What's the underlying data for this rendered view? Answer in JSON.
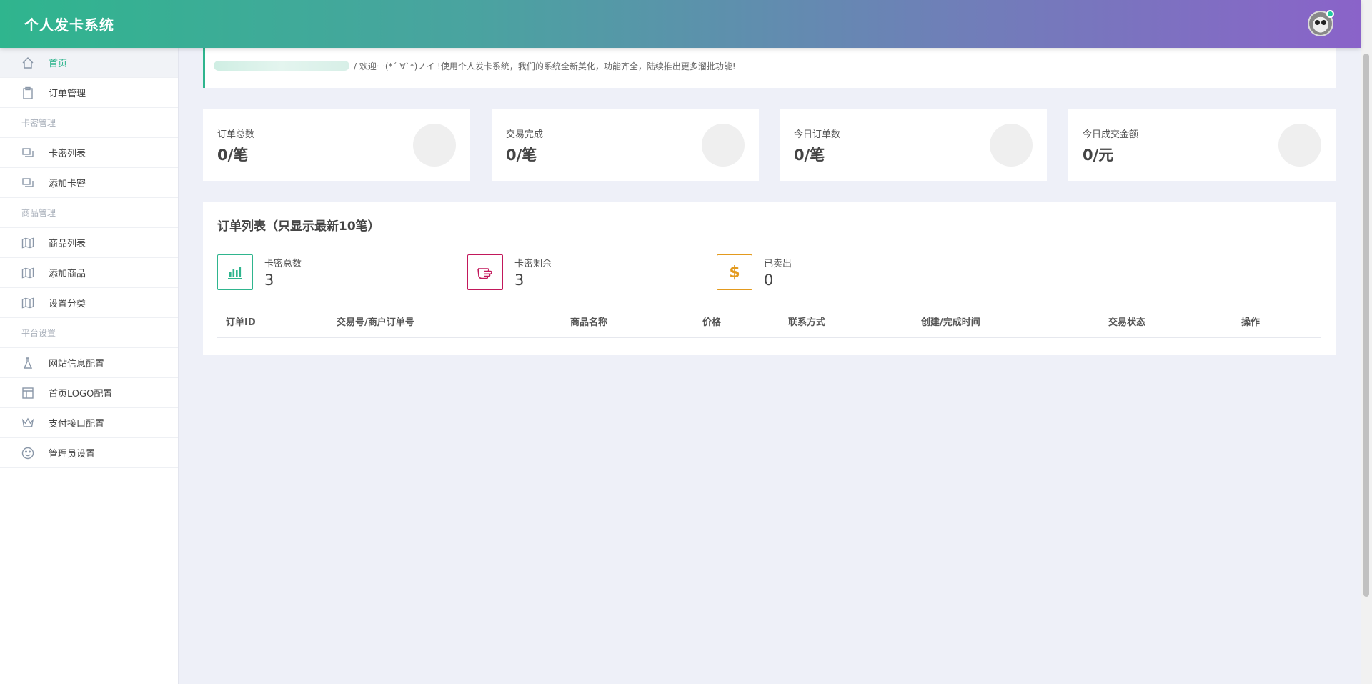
{
  "app": {
    "title": "个人发卡系统"
  },
  "sidebar": {
    "items": [
      {
        "type": "item",
        "label": "首页",
        "icon": "home-icon",
        "active": true
      },
      {
        "type": "item",
        "label": "订单管理",
        "icon": "clipboard-icon"
      },
      {
        "type": "group",
        "label": "卡密管理"
      },
      {
        "type": "item",
        "label": "卡密列表",
        "icon": "cards-icon"
      },
      {
        "type": "item",
        "label": "添加卡密",
        "icon": "cards-icon"
      },
      {
        "type": "group",
        "label": "商品管理"
      },
      {
        "type": "item",
        "label": "商品列表",
        "icon": "map-icon"
      },
      {
        "type": "item",
        "label": "添加商品",
        "icon": "map-icon"
      },
      {
        "type": "item",
        "label": "设置分类",
        "icon": "map-icon"
      },
      {
        "type": "group",
        "label": "平台设置"
      },
      {
        "type": "item",
        "label": "网站信息配置",
        "icon": "flask-icon"
      },
      {
        "type": "item",
        "label": "首页LOGO配置",
        "icon": "layout-icon"
      },
      {
        "type": "item",
        "label": "支付接口配置",
        "icon": "crown-icon"
      },
      {
        "type": "item",
        "label": "管理员设置",
        "icon": "smile-icon"
      }
    ]
  },
  "welcome": {
    "message": "/  欢迎ー(*´ ∀`*)ノイ !使用个人发卡系统，我们的系统全新美化，功能齐全，陆续推出更多溜批功能!"
  },
  "stats": [
    {
      "label": "订单总数",
      "value": "0/笔"
    },
    {
      "label": "交易完成",
      "value": "0/笔"
    },
    {
      "label": "今日订单数",
      "value": "0/笔"
    },
    {
      "label": "今日成交金额",
      "value": "0/元"
    }
  ],
  "orders": {
    "title": "订单列表（只显示最新10笔）",
    "summary": [
      {
        "label": "卡密总数",
        "value": "3",
        "icon": "bar-chart-icon",
        "color": "#2fb58e"
      },
      {
        "label": "卡密剩余",
        "value": "3",
        "icon": "hand-pointing-icon",
        "color": "#c2185b"
      },
      {
        "label": "已卖出",
        "value": "0",
        "icon": "dollar-icon",
        "color": "#e39a1e"
      }
    ],
    "columns": [
      "订单ID",
      "交易号/商户订单号",
      "商品名称",
      "价格",
      "联系方式",
      "创建/完成时间",
      "交易状态",
      "操作"
    ]
  }
}
